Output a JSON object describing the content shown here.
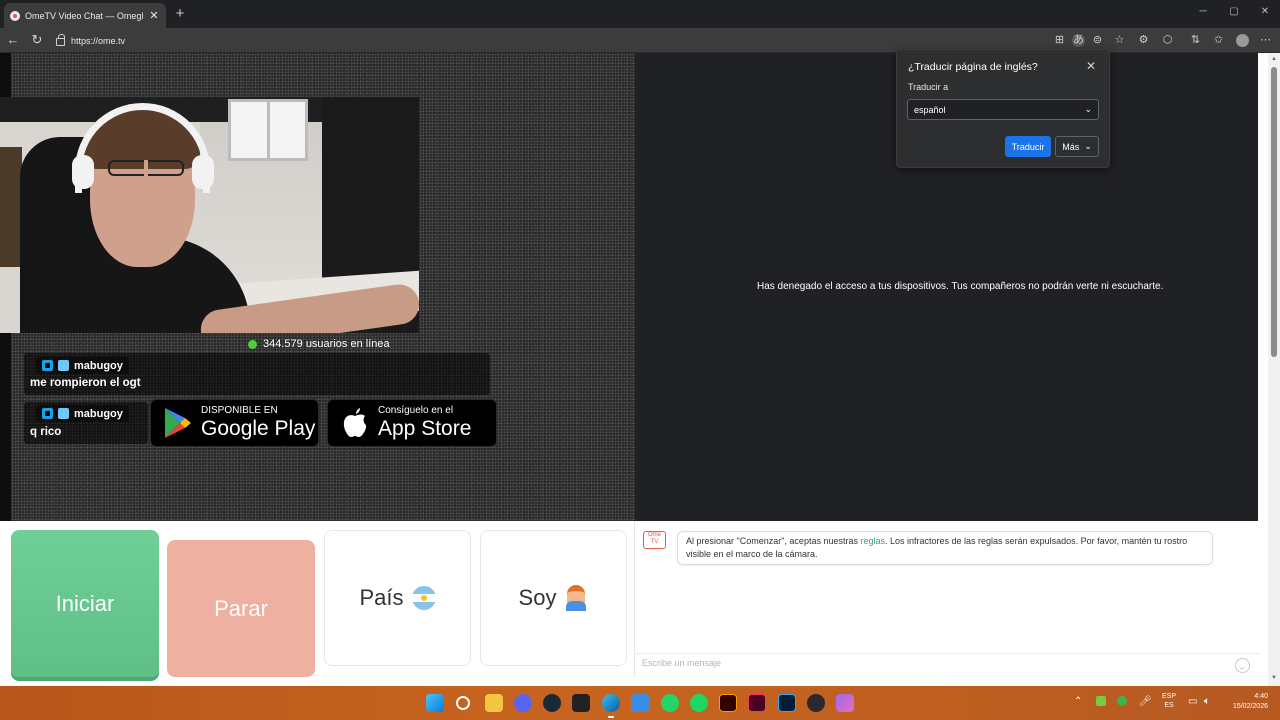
{
  "browser": {
    "tab_title": "OmeTV Video Chat — Omegle Ra",
    "url": "https://ome.tv",
    "tab_close": "✕",
    "new_tab": "+"
  },
  "translate_popup": {
    "title": "¿Traducir página de inglés?",
    "label": "Traducir a",
    "language": "español",
    "translate_button": "Traducir",
    "more_button": "Más"
  },
  "video": {
    "online_count": "344.579 usuarios en línea",
    "denied_message": "Has denegado el acceso a tus dispositivos. Tus compañeros no podrán verte ni escucharte."
  },
  "chat_overlay": [
    {
      "user": "mabugoy",
      "text": "me rompieron el ogt"
    },
    {
      "user": "mabugoy",
      "text": "q rico"
    }
  ],
  "store_badges": {
    "google_small": "DISPONIBLE EN",
    "google_big": "Google Play",
    "apple_small": "Consíguelo en el",
    "apple_big": "App Store"
  },
  "controls": {
    "start": "Iniciar",
    "stop": "Parar",
    "country": "País",
    "soy": "Soy"
  },
  "chat": {
    "logo_text": "Ome TV",
    "rules_prefix": "Al presionar \"Comenzar\", aceptas nuestras ",
    "rules_link": "reglas",
    "rules_suffix": ". Los infractores de las reglas serán expulsados. Por favor, mantén tu rostro visible en el marco de la cámara.",
    "input_placeholder": "Escribe un mensaje"
  },
  "taskbar": {
    "lang_top": "ESP",
    "lang_bottom": "ES",
    "time": "4:40",
    "date": "15/02/2026"
  },
  "colors": {
    "start_green": "#6fcf97",
    "stop_salmon": "#eeb0a0",
    "translate_blue": "#1a73e8",
    "online_green": "#4cd137"
  }
}
